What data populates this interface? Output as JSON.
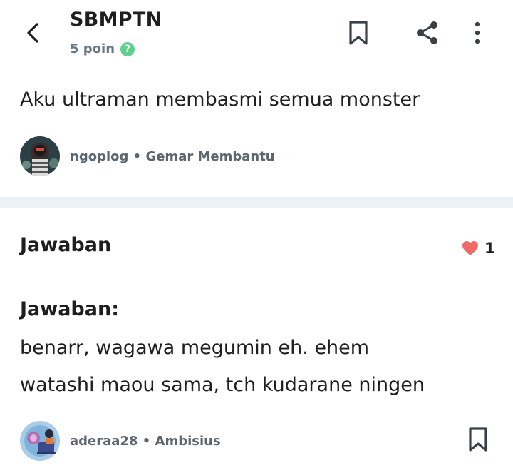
{
  "header": {
    "title": "SBMPTN",
    "points": "5 poin",
    "back_icon": "chevron-left-icon",
    "question_mark": "?",
    "actions": [
      "bookmark-icon",
      "share-icon",
      "more-vertical-icon"
    ]
  },
  "question": {
    "text": "Aku ultraman membasmi semua monster",
    "author": "ngopiog",
    "rank": "Gemar Membantu",
    "separator": "•"
  },
  "answer": {
    "section_title": "Jawaban",
    "likes": "1",
    "heading": "Jawaban:",
    "line1": "benarr, wagawa megumin eh. ehem",
    "line2": "watashi maou sama, tch kudarane ningen",
    "author": "aderaa28",
    "rank": "Ambisius",
    "separator": "•"
  },
  "colors": {
    "accent_green": "#5fd08e",
    "heart": "#f06a6a",
    "divider": "#ebf1f6",
    "muted_text": "#5c6670"
  }
}
